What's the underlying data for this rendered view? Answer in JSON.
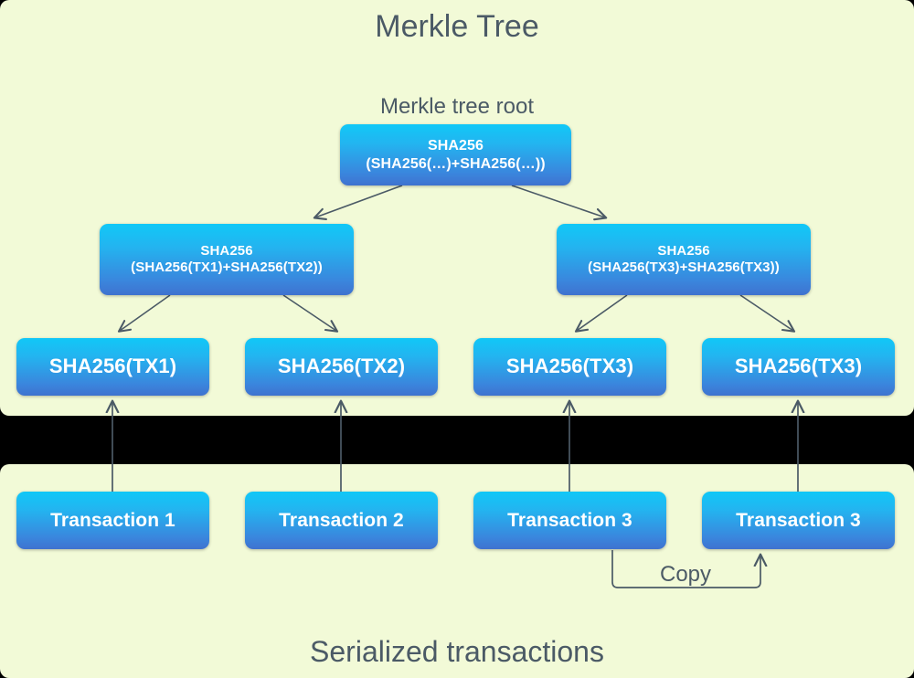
{
  "title": "Merkle Tree",
  "root_label": "Merkle tree root",
  "bottom_caption": "Serialized transactions",
  "copy_label": "Copy",
  "colors": {
    "background": "#f2fad7",
    "band": "#000000",
    "node_top": "#11c8f7",
    "node_bottom": "#3f72cf",
    "text_dark": "#4b5a66",
    "node_text": "#ffffff",
    "arrow": "#4b5a66"
  },
  "root": {
    "line1": "SHA256",
    "line2": "(SHA256(…)+SHA256(…))"
  },
  "level2": [
    {
      "line1": "SHA256",
      "line2": "(SHA256(TX1)+SHA256(TX2))"
    },
    {
      "line1": "SHA256",
      "line2": "(SHA256(TX3)+SHA256(TX3))"
    }
  ],
  "leaves": [
    {
      "label": "SHA256(TX1)"
    },
    {
      "label": "SHA256(TX2)"
    },
    {
      "label": "SHA256(TX3)"
    },
    {
      "label": "SHA256(TX3)"
    }
  ],
  "transactions": [
    {
      "label": "Transaction 1"
    },
    {
      "label": "Transaction 2"
    },
    {
      "label": "Transaction 3"
    },
    {
      "label": "Transaction 3"
    }
  ]
}
